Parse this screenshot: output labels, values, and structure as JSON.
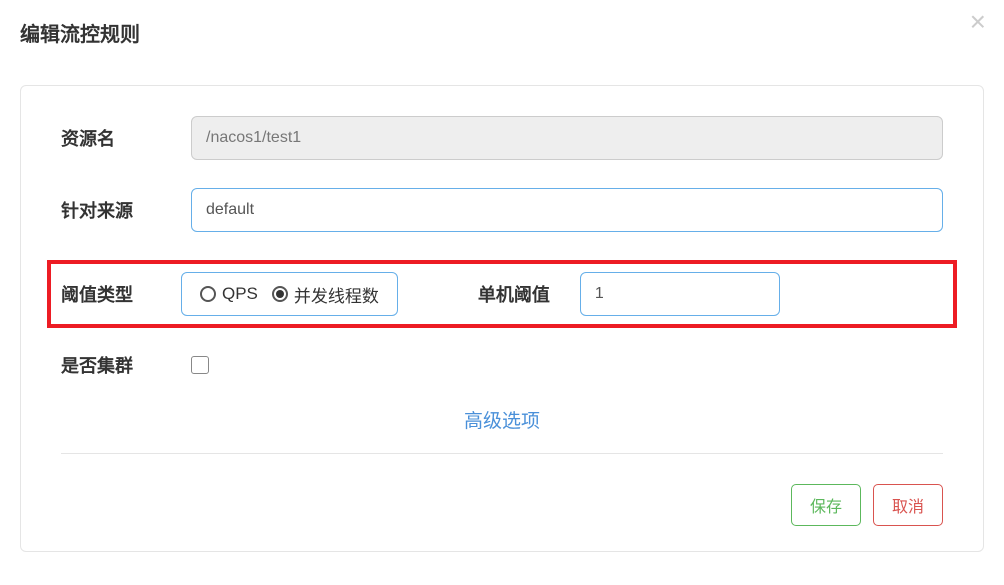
{
  "modal": {
    "title": "编辑流控规则"
  },
  "form": {
    "resource_label": "资源名",
    "resource_value": "/nacos1/test1",
    "source_label": "针对来源",
    "source_value": "default",
    "threshold_type_label": "阈值类型",
    "threshold_type_options": {
      "qps": "QPS",
      "threads": "并发线程数"
    },
    "threshold_value_label": "单机阈值",
    "threshold_value": "1",
    "cluster_label": "是否集群",
    "advanced_label": "高级选项"
  },
  "buttons": {
    "save": "保存",
    "cancel": "取消"
  }
}
